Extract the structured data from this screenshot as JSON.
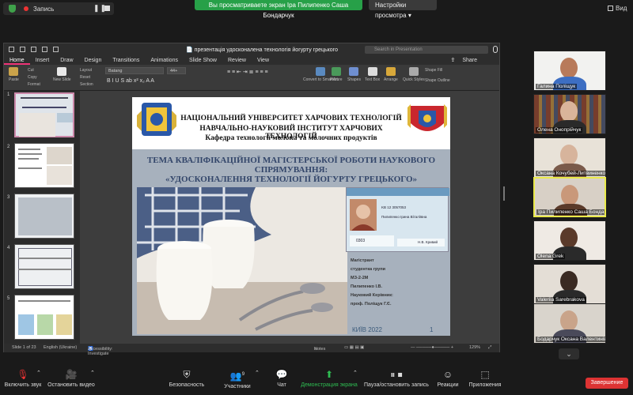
{
  "topbar": {
    "recording_label": "Запись",
    "sharing_banner": "Вы просматриваете экран Іра Пилипенко Саша Бондарчук",
    "view_settings": "Настройки просмотра",
    "view_button": "Вид"
  },
  "ppt": {
    "file_title": "презентація удосконалена технологія йогурту грецького",
    "search_placeholder": "Search in Presentation",
    "share_label": "Share",
    "menu": [
      "Home",
      "Insert",
      "Draw",
      "Design",
      "Transitions",
      "Animations",
      "Slide Show",
      "Review",
      "View"
    ],
    "active_menu": "Home",
    "ribbon": {
      "paste": "Paste",
      "cut": "Cut",
      "copy": "Copy",
      "format": "Format",
      "new_slide": "New Slide",
      "layout": "Layout",
      "reset": "Reset",
      "section": "Section",
      "font": "Batang",
      "font_size": "44+",
      "convert_smartart": "Convert to SmartArt",
      "picture": "Picture",
      "shapes": "Shapes",
      "text_box": "Text Box",
      "arrange": "Arrange",
      "quick_styles": "Quick Styles",
      "shape_fill": "Shape Fill",
      "shape_outline": "Shape Outline"
    },
    "slide_numbers": [
      "1",
      "2",
      "3",
      "4",
      "5"
    ],
    "slide": {
      "institution_lines": [
        "НАЦІОНАЛЬНИЙ УНІВЕРСИТЕТ ХАРЧОВИХ ТЕХНОЛОГІЙ",
        "НАВЧАЛЬНО-НАУКОВИЙ ІНСТИТУТ ХАРЧОВИХ ТЕХНОЛОГІЙ",
        "Кафедра технології молока та молочних продуктів"
      ],
      "theme_lines": [
        "ТЕМА КВАЛІФІКАЦІЙНОЇ МАГІСТЕРСЬКОЇ РОБОТИ НАУКОВОГО",
        "СПРЯМУВАННЯ:",
        "«УДОСКОНАЛЕННЯ ТЕХНОЛОГІЇ ЙОГУРТУ ГРЕЦЬКОГО»"
      ],
      "info_lines": [
        "Магістрант",
        "студентка групи",
        "МЗ-2-2М",
        "Пилипенко І.В.",
        "Науковий Керівник:",
        "проф. Поліщук Г.Є."
      ],
      "city_year": "КИЇВ 2022",
      "page_number": "1",
      "id_card_name": "Пилипенко Ірина Віталіївна",
      "id_card_number": "KB 12 3057053",
      "id_card_code": "0303",
      "id_card_footer": "Н.В. Кривий"
    },
    "status": {
      "slide_of": "Slide 1 of 23",
      "language": "English (Ukraine)",
      "accessibility": "Accessibility: Investigate",
      "notes": "Notes",
      "zoom": "129%"
    }
  },
  "participants": [
    {
      "name": "Галина Поліщук"
    },
    {
      "name": "Олена Онопрійчук"
    },
    {
      "name": "Оксана Кочубей-Литвиненко"
    },
    {
      "name": "Іра Пилипенко Саша Бондарчук"
    },
    {
      "name": "Olena Grek"
    },
    {
      "name": "Valeriia Sarebrakova"
    },
    {
      "name": "Бодарчук Оксана Валентинівна"
    }
  ],
  "toolbar": {
    "mute": "Включить звук",
    "video": "Остановить видео",
    "security": "Безопасность",
    "participants": "Участники",
    "participants_count": "9",
    "chat": "Чат",
    "share_screen": "Демонстрация экрана",
    "pause_recording": "Пауза/остановить запись",
    "reactions": "Реакции",
    "apps": "Приложения",
    "end": "Завершение"
  },
  "colors": {
    "sharing_green": "#27a048",
    "end_red": "#d33333",
    "active_tile_border": "#e9e94a"
  }
}
